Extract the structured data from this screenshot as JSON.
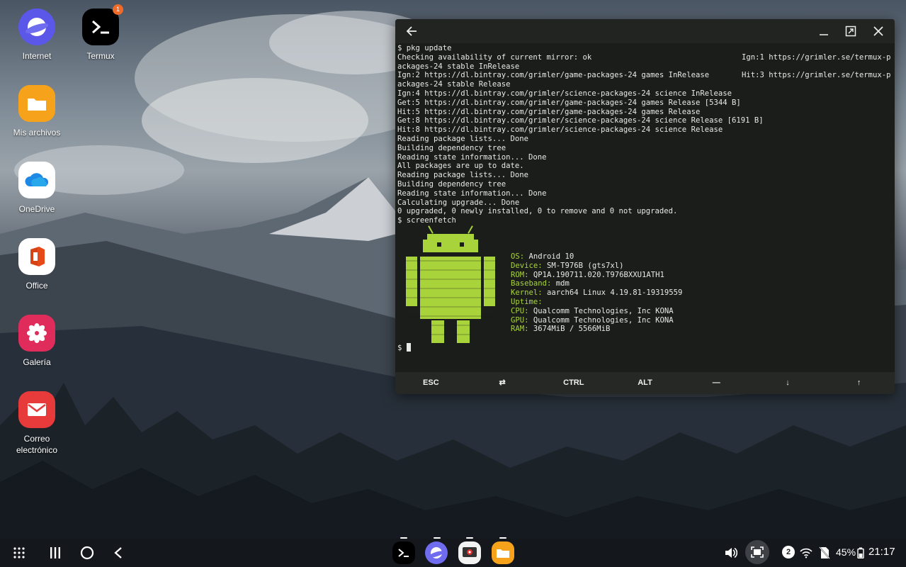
{
  "desktop": {
    "icons": [
      {
        "label": "Internet",
        "icon": "samsung-internet-icon",
        "color": "#6f6cf0"
      },
      {
        "label": "Termux",
        "icon": "termux-icon",
        "color": "#000000",
        "badge": "1"
      },
      {
        "label": "Mis archivos",
        "icon": "folder-icon",
        "color": "#f7a21b"
      },
      {
        "label": "OneDrive",
        "icon": "onedrive-icon",
        "color": "#ffffff"
      },
      {
        "label": "Office",
        "icon": "office-icon",
        "color": "#ffffff"
      },
      {
        "label": "Galería",
        "icon": "gallery-flower-icon",
        "color": "#e02c5a"
      },
      {
        "label": "Correo electrónico",
        "label_line1": "Correo",
        "label_line2": "electrónico",
        "icon": "mail-icon",
        "color": "#e73a3a"
      }
    ]
  },
  "terminal": {
    "lines": [
      {
        "text": "$ pkg update"
      },
      {
        "text": "Checking availability of current mirror: ok",
        "right": "Ign:1 https://grimler.se/termux-p"
      },
      {
        "text": "ackages-24 stable InRelease"
      },
      {
        "text": "Ign:2 https://dl.bintray.com/grimler/game-packages-24 games InRelease",
        "right": "Hit:3 https://grimler.se/termux-p"
      },
      {
        "text": "ackages-24 stable Release"
      },
      {
        "text": "Ign:4 https://dl.bintray.com/grimler/science-packages-24 science InRelease"
      },
      {
        "text": "Get:5 https://dl.bintray.com/grimler/game-packages-24 games Release [5344 B]"
      },
      {
        "text": "Hit:5 https://dl.bintray.com/grimler/game-packages-24 games Release"
      },
      {
        "text": "Get:8 https://dl.bintray.com/grimler/science-packages-24 science Release [6191 B]"
      },
      {
        "text": "Hit:8 https://dl.bintray.com/grimler/science-packages-24 science Release"
      },
      {
        "text": "Reading package lists... Done"
      },
      {
        "text": "Building dependency tree"
      },
      {
        "text": "Reading state information... Done"
      },
      {
        "text": "All packages are up to date."
      },
      {
        "text": "Reading package lists... Done"
      },
      {
        "text": "Building dependency tree"
      },
      {
        "text": "Reading state information... Done"
      },
      {
        "text": "Calculating upgrade... Done"
      },
      {
        "text": "0 upgraded, 0 newly installed, 0 to remove and 0 not upgraded."
      },
      {
        "text": "$ screenfetch"
      }
    ],
    "screenfetch": [
      {
        "key": "OS:",
        "value": " Android 10"
      },
      {
        "key": "Device:",
        "value": " SM-T976B (gts7xl)"
      },
      {
        "key": "ROM:",
        "value": " QP1A.190711.020.T976BXXU1ATH1"
      },
      {
        "key": "Baseband:",
        "value": " mdm"
      },
      {
        "key": "Kernel:",
        "value": " aarch64 Linux 4.19.81-19319559"
      },
      {
        "key": "Uptime:",
        "value": ""
      },
      {
        "key": "CPU:",
        "value": " Qualcomm Technologies, Inc KONA"
      },
      {
        "key": "GPU:",
        "value": " Qualcomm Technologies, Inc KONA"
      },
      {
        "key": "RAM:",
        "value": " 3674MiB / 5566MiB"
      }
    ],
    "prompt": "$ ",
    "accent_color": "#a9d33a",
    "extra_keys": [
      "ESC",
      "⇄",
      "CTRL",
      "ALT",
      "—",
      "↓",
      "↑"
    ]
  },
  "window": {
    "back_icon": "arrow-left-icon",
    "minimize_icon": "minimize-icon",
    "maximize_icon": "maximize-icon",
    "close_icon": "close-icon"
  },
  "taskbar": {
    "dock": [
      "termux-icon",
      "samsung-internet-icon",
      "screen-recorder-icon",
      "folder-icon"
    ],
    "notification_count": "2",
    "battery": "45%",
    "time": "21:17"
  }
}
